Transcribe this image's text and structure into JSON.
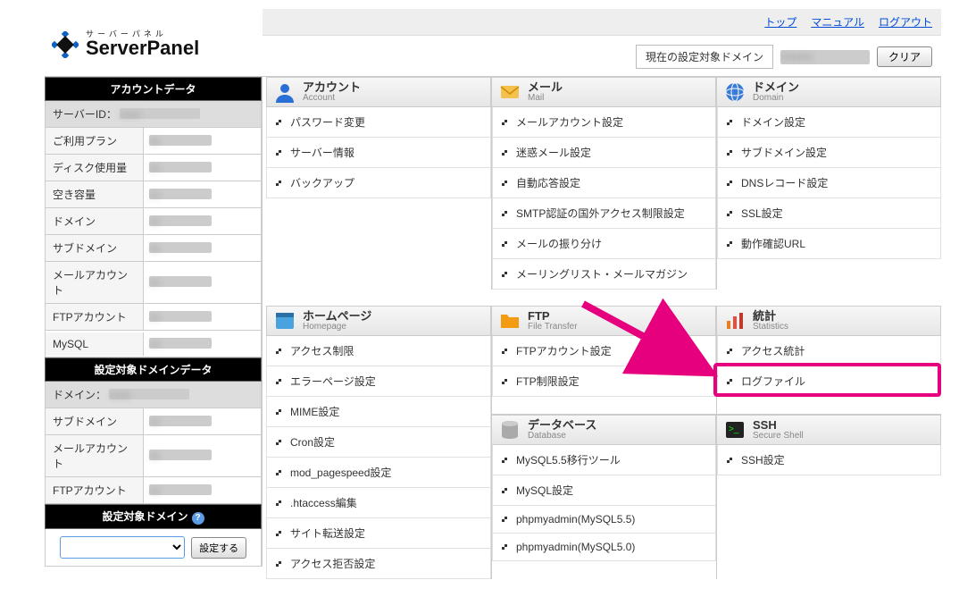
{
  "logo": {
    "kana": "サーバーパネル",
    "name": "ServerPanel"
  },
  "topnav": {
    "top": "トップ",
    "manual": "マニュアル",
    "logout": "ログアウト"
  },
  "current_domain_label": "現在の設定対象ドメイン",
  "clear_label": "クリア",
  "sidebar": {
    "account_title": "アカウントデータ",
    "rows": [
      {
        "label": "サーバーID："
      },
      {
        "label": "ご利用プラン"
      },
      {
        "label": "ディスク使用量"
      },
      {
        "label": "空き容量"
      },
      {
        "label": "ドメイン"
      },
      {
        "label": "サブドメイン"
      },
      {
        "label": "メールアカウント"
      },
      {
        "label": "FTPアカウント"
      },
      {
        "label": "MySQL"
      }
    ],
    "domain_data_title": "設定対象ドメインデータ",
    "domain_rows": [
      {
        "label": "ドメイン："
      },
      {
        "label": "サブドメイン"
      },
      {
        "label": "メールアカウント"
      },
      {
        "label": "FTPアカウント"
      }
    ],
    "target_title": "設定対象ドメイン",
    "set_btn": "設定する"
  },
  "categories": {
    "account": {
      "title": "アカウント",
      "sub": "Account",
      "links": [
        "パスワード変更",
        "サーバー情報",
        "バックアップ"
      ]
    },
    "mail": {
      "title": "メール",
      "sub": "Mail",
      "links": [
        "メールアカウント設定",
        "迷惑メール設定",
        "自動応答設定",
        "SMTP認証の国外アクセス制限設定",
        "メールの振り分け",
        "メーリングリスト・メールマガジン"
      ]
    },
    "domain": {
      "title": "ドメイン",
      "sub": "Domain",
      "links": [
        "ドメイン設定",
        "サブドメイン設定",
        "DNSレコード設定",
        "SSL設定",
        "動作確認URL"
      ]
    },
    "homepage": {
      "title": "ホームページ",
      "sub": "Homepage",
      "links": [
        "アクセス制限",
        "エラーページ設定",
        "MIME設定",
        "Cron設定",
        "mod_pagespeed設定",
        ".htaccess編集",
        "サイト転送設定",
        "アクセス拒否設定"
      ]
    },
    "ftp": {
      "title": "FTP",
      "sub": "File Transfer",
      "links": [
        "FTPアカウント設定",
        "FTP制限設定"
      ]
    },
    "database": {
      "title": "データベース",
      "sub": "Database",
      "links": [
        "MySQL5.5移行ツール",
        "MySQL設定",
        "phpmyadmin(MySQL5.5)",
        "phpmyadmin(MySQL5.0)"
      ]
    },
    "stats": {
      "title": "統計",
      "sub": "Statistics",
      "links": [
        "アクセス統計",
        "ログファイル"
      ]
    },
    "ssh": {
      "title": "SSH",
      "sub": "Secure Shell",
      "links": [
        "SSH設定"
      ]
    }
  },
  "highlight_target": "ログファイル"
}
